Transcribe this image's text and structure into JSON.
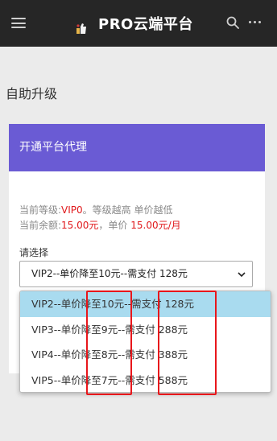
{
  "header": {
    "title": "PRO云端平台",
    "icons": [
      "menu-icon",
      "logo-icon",
      "search-icon",
      "more-icon"
    ]
  },
  "page": {
    "heading": "自助升级"
  },
  "card": {
    "title": "开通平台代理",
    "level": {
      "prefix": "当前等级:",
      "value": "VIP0",
      "suffix": "。等级越高 单价越低"
    },
    "balance": {
      "prefix": "当前余额:",
      "value": "15.00元",
      "mid": "，单价",
      "price": "15.00元/月"
    },
    "select_label": "请选择",
    "selected_value": "VIP2--单价降至10元--需支付 128元"
  },
  "dropdown": {
    "options": [
      "VIP2--单价降至10元--需支付 128元",
      "VIP3--单价降至9元--需支付 288元",
      "VIP4--单价降至8元--需支付 388元",
      "VIP5--单价降至7元--需支付 588元"
    ],
    "selected_index": 0
  },
  "colors": {
    "header_bg": "#262626",
    "card_header_bg": "#6a5bd4",
    "highlight_red": "#e0181b",
    "selected_option_bg": "#a9dbef"
  }
}
